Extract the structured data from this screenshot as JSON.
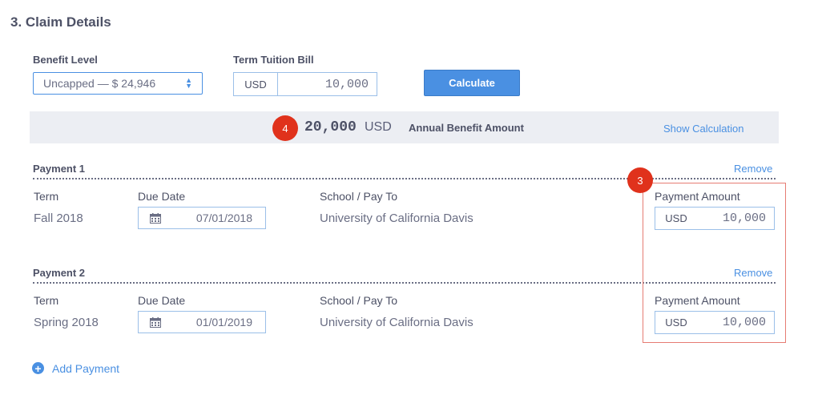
{
  "section": {
    "title": "3.  Claim Details"
  },
  "benefit_level": {
    "label": "Benefit Level",
    "value": "Uncapped — $ 24,946"
  },
  "tuition": {
    "label": "Term Tuition Bill",
    "currency": "USD",
    "amount": "10,000"
  },
  "calculate_label": "Calculate",
  "annual": {
    "badge": "4",
    "amount": "20,000",
    "currency": "USD",
    "label": "Annual Benefit Amount",
    "show_calc": "Show Calculation"
  },
  "annotation_badge": "3",
  "payments": [
    {
      "title": "Payment 1",
      "remove": "Remove",
      "term_label": "Term",
      "term": "Fall 2018",
      "due_label": "Due Date",
      "due": "07/01/2018",
      "school_label": "School / Pay To",
      "school": "University of California Davis",
      "amount_label": "Payment Amount",
      "currency": "USD",
      "amount": "10,000"
    },
    {
      "title": "Payment 2",
      "remove": "Remove",
      "term_label": "Term",
      "term": "Spring 2018",
      "due_label": "Due Date",
      "due": "01/01/2019",
      "school_label": "School / Pay To",
      "school": "University of California Davis",
      "amount_label": "Payment Amount",
      "currency": "USD",
      "amount": "10,000"
    }
  ],
  "add_payment": "Add Payment",
  "colors": {
    "accent": "#4a90e2",
    "badge": "#e0321c",
    "annotation_box": "#e67c73",
    "bar_bg": "#eceef3"
  },
  "icons": [
    "calendar-icon",
    "plus-circle-icon",
    "sort-caret-icon"
  ]
}
